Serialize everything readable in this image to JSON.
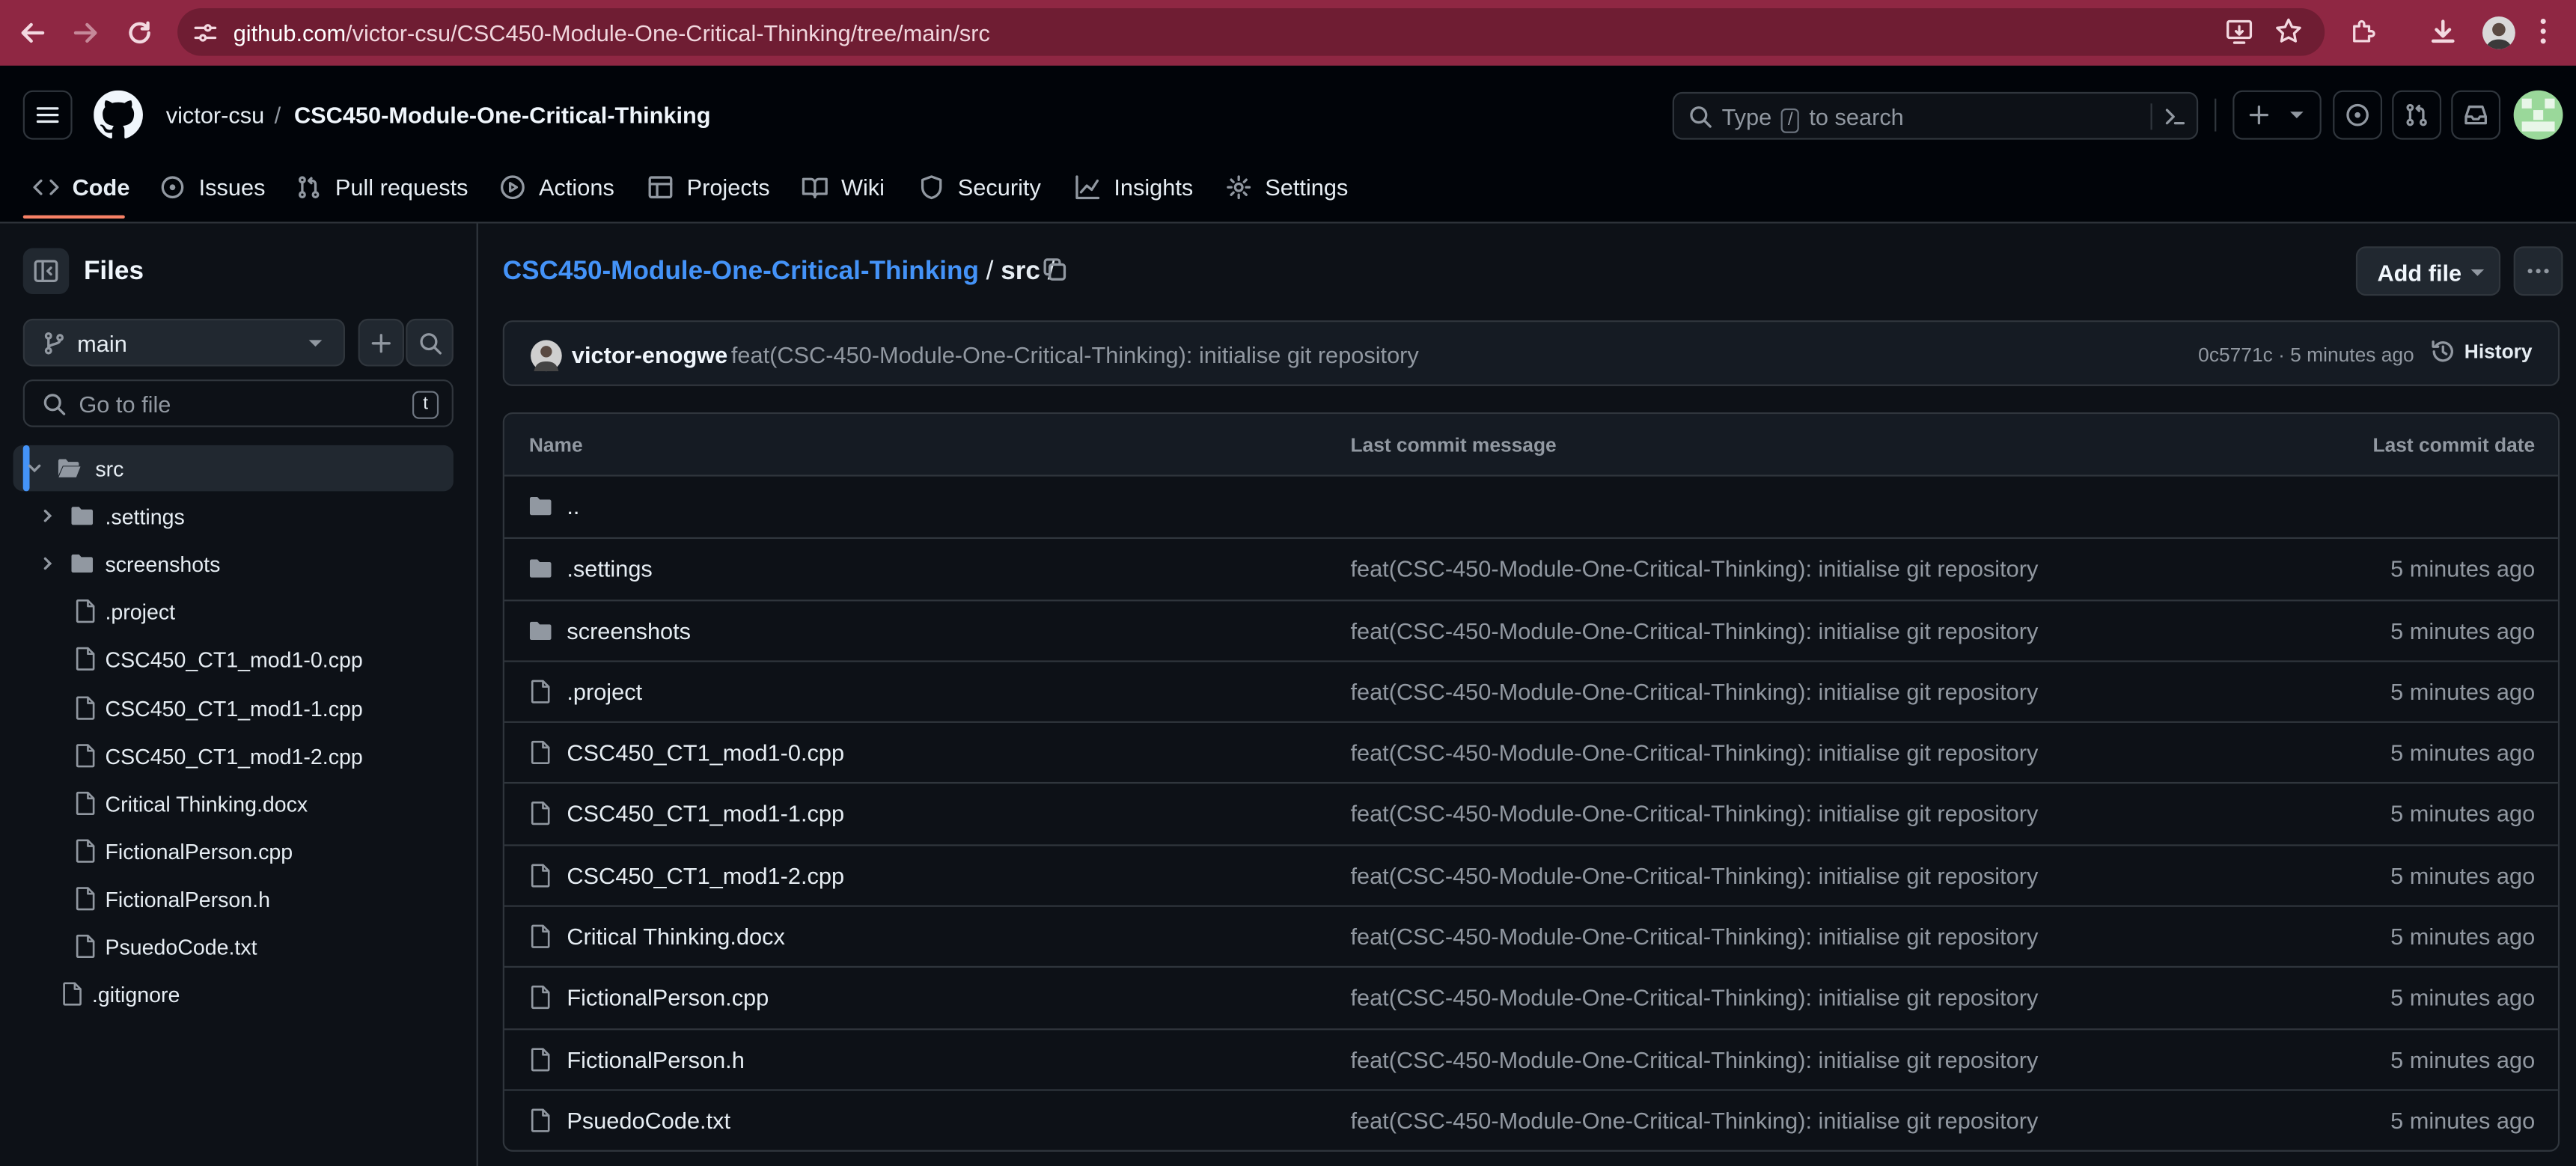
{
  "browser": {
    "url_host": "github.com",
    "url_path": "/victor-csu/CSC450-Module-One-Critical-Thinking/tree/main/src"
  },
  "header": {
    "owner": "victor-csu",
    "separator": "/",
    "repo": "CSC450-Module-One-Critical-Thinking",
    "search_prefix": "Type",
    "search_key": "/",
    "search_suffix": "to search"
  },
  "tabs": [
    {
      "label": "Code",
      "icon": "code-icon",
      "active": true
    },
    {
      "label": "Issues",
      "icon": "issue-icon"
    },
    {
      "label": "Pull requests",
      "icon": "pull-request-icon"
    },
    {
      "label": "Actions",
      "icon": "play-icon"
    },
    {
      "label": "Projects",
      "icon": "table-icon"
    },
    {
      "label": "Wiki",
      "icon": "book-icon"
    },
    {
      "label": "Security",
      "icon": "shield-icon"
    },
    {
      "label": "Insights",
      "icon": "graph-icon"
    },
    {
      "label": "Settings",
      "icon": "gear-icon"
    }
  ],
  "sidebar": {
    "title": "Files",
    "branch": "main",
    "goto_placeholder": "Go to file",
    "goto_key": "t",
    "tree": [
      {
        "label": "src",
        "type": "folder-open",
        "expanded": true,
        "selected": true,
        "depth": 0
      },
      {
        "label": ".settings",
        "type": "folder",
        "depth": 1
      },
      {
        "label": "screenshots",
        "type": "folder",
        "depth": 1
      },
      {
        "label": ".project",
        "type": "file",
        "depth": 1
      },
      {
        "label": "CSC450_CT1_mod1-0.cpp",
        "type": "file",
        "depth": 1
      },
      {
        "label": "CSC450_CT1_mod1-1.cpp",
        "type": "file",
        "depth": 1
      },
      {
        "label": "CSC450_CT1_mod1-2.cpp",
        "type": "file",
        "depth": 1
      },
      {
        "label": "Critical Thinking.docx",
        "type": "file",
        "depth": 1
      },
      {
        "label": "FictionalPerson.cpp",
        "type": "file",
        "depth": 1
      },
      {
        "label": "FictionalPerson.h",
        "type": "file",
        "depth": 1
      },
      {
        "label": "PsuedoCode.txt",
        "type": "file",
        "depth": 1
      },
      {
        "label": ".gitignore",
        "type": "file",
        "depth": 0
      }
    ]
  },
  "main": {
    "breadcrumb_repo": "CSC450-Module-One-Critical-Thinking",
    "breadcrumb_sep": "/",
    "breadcrumb_dir": "src",
    "breadcrumb_trail": "/",
    "add_file": "Add file",
    "commit": {
      "author": "victor-enogwe",
      "message": "feat(CSC-450-Module-One-Critical-Thinking): initialise git repository",
      "sha_time": "0c5771c · 5 minutes ago",
      "history": "History"
    },
    "columns": {
      "name": "Name",
      "message": "Last commit message",
      "date": "Last commit date"
    },
    "rows": [
      {
        "name": "..",
        "type": "folder",
        "message": "",
        "date": ""
      },
      {
        "name": ".settings",
        "type": "folder",
        "message": "feat(CSC-450-Module-One-Critical-Thinking): initialise git repository",
        "date": "5 minutes ago"
      },
      {
        "name": "screenshots",
        "type": "folder",
        "message": "feat(CSC-450-Module-One-Critical-Thinking): initialise git repository",
        "date": "5 minutes ago"
      },
      {
        "name": ".project",
        "type": "file",
        "message": "feat(CSC-450-Module-One-Critical-Thinking): initialise git repository",
        "date": "5 minutes ago"
      },
      {
        "name": "CSC450_CT1_mod1-0.cpp",
        "type": "file",
        "message": "feat(CSC-450-Module-One-Critical-Thinking): initialise git repository",
        "date": "5 minutes ago"
      },
      {
        "name": "CSC450_CT1_mod1-1.cpp",
        "type": "file",
        "message": "feat(CSC-450-Module-One-Critical-Thinking): initialise git repository",
        "date": "5 minutes ago"
      },
      {
        "name": "CSC450_CT1_mod1-2.cpp",
        "type": "file",
        "message": "feat(CSC-450-Module-One-Critical-Thinking): initialise git repository",
        "date": "5 minutes ago"
      },
      {
        "name": "Critical Thinking.docx",
        "type": "file",
        "message": "feat(CSC-450-Module-One-Critical-Thinking): initialise git repository",
        "date": "5 minutes ago"
      },
      {
        "name": "FictionalPerson.cpp",
        "type": "file",
        "message": "feat(CSC-450-Module-One-Critical-Thinking): initialise git repository",
        "date": "5 minutes ago"
      },
      {
        "name": "FictionalPerson.h",
        "type": "file",
        "message": "feat(CSC-450-Module-One-Critical-Thinking): initialise git repository",
        "date": "5 minutes ago"
      },
      {
        "name": "PsuedoCode.txt",
        "type": "file",
        "message": "feat(CSC-450-Module-One-Critical-Thinking): initialise git repository",
        "date": "5 minutes ago"
      }
    ]
  },
  "colors": {
    "browser_bar": "#8f2743",
    "accent_link": "#4493f8",
    "active_tab": "#f78166",
    "page_bg": "#0d1117"
  }
}
